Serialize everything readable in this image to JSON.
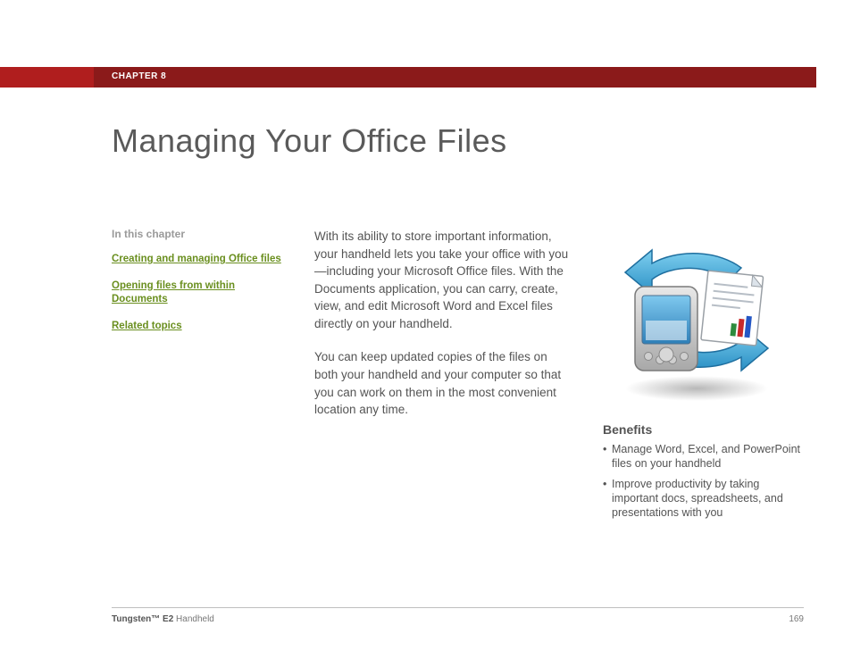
{
  "header": {
    "chapter_label": "CHAPTER 8"
  },
  "title": "Managing Your Office Files",
  "sidebar": {
    "heading": "In this chapter",
    "links": [
      "Creating and managing Office files",
      "Opening files from within Documents",
      "Related topics"
    ]
  },
  "body": {
    "p1": "With its ability to store important information, your handheld lets you take your office with you—including your Microsoft Office files. With the Documents application, you can carry, create, view, and edit Microsoft Word and Excel files directly on your handheld.",
    "p2": "You can keep updated copies of the files on both your handheld and your computer so that you can work on them in the most convenient location any time."
  },
  "benefits": {
    "heading": "Benefits",
    "items": [
      "Manage Word, Excel, and PowerPoint files on your handheld",
      "Improve productivity by taking important docs, spreadsheets, and presentations with you"
    ]
  },
  "footer": {
    "product_bold": "Tungsten™ E2",
    "product_rest": " Handheld",
    "page_number": "169"
  }
}
